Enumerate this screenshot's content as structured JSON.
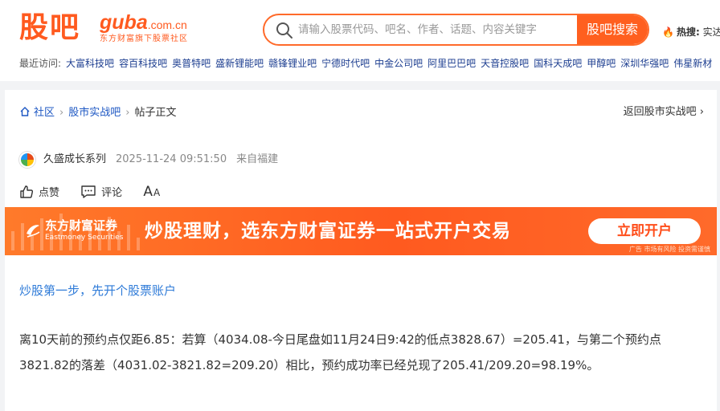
{
  "header": {
    "logo_cn": "股吧",
    "logo_en": "guba",
    "logo_domain": ".com.cn",
    "logo_sub": "东方财富旗下股票社区",
    "search_placeholder": "请输入股票代码、吧名、作者、话题、内容关键字",
    "search_button": "股吧搜索",
    "hot_label": "热搜:",
    "hot_item": "实达"
  },
  "recent": {
    "label": "最近访问:",
    "items": [
      "大富科技吧",
      "容百科技吧",
      "奥普特吧",
      "盛新锂能吧",
      "赣锋锂业吧",
      "宁德时代吧",
      "中金公司吧",
      "阿里巴巴吧",
      "天音控股吧",
      "国科天成吧",
      "甲醇吧",
      "深圳华强吧",
      "伟星新材"
    ]
  },
  "breadcrumb": {
    "items": [
      "社区",
      "股市实战吧"
    ],
    "current": "帖子正文",
    "back": "返回股市实战吧"
  },
  "post": {
    "author": "久盛成长系列",
    "time": "2025-11-24 09:51:50",
    "from": "来自福建",
    "like": "点赞",
    "comment": "评论",
    "font_big": "A",
    "font_small": "A"
  },
  "banner": {
    "brand": "东方财富证券",
    "brand_en": "Eastmoney Securities",
    "slogan": "炒股理财，选东方财富证券一站式开户交易",
    "button": "立即开户",
    "ad_note": "广告 市场有风险 投资需谨慎"
  },
  "article": {
    "promo": "炒股第一步，先开个股票账户",
    "p1": "离10天前的预约点仅距6.85：若算（4034.08-今日尾盘如11月24日9:42的低点3828.67）=205.41，与第二个预约点",
    "p2": "3821.82的落差（4031.02-3821.82=209.20）相比，预约成功率已经兑现了205.41/209.20=98.19%。"
  },
  "colors": {
    "brand_orange": "#ff5a1f",
    "link_blue": "#1d3e90",
    "promo_blue": "#2f7bd8"
  }
}
